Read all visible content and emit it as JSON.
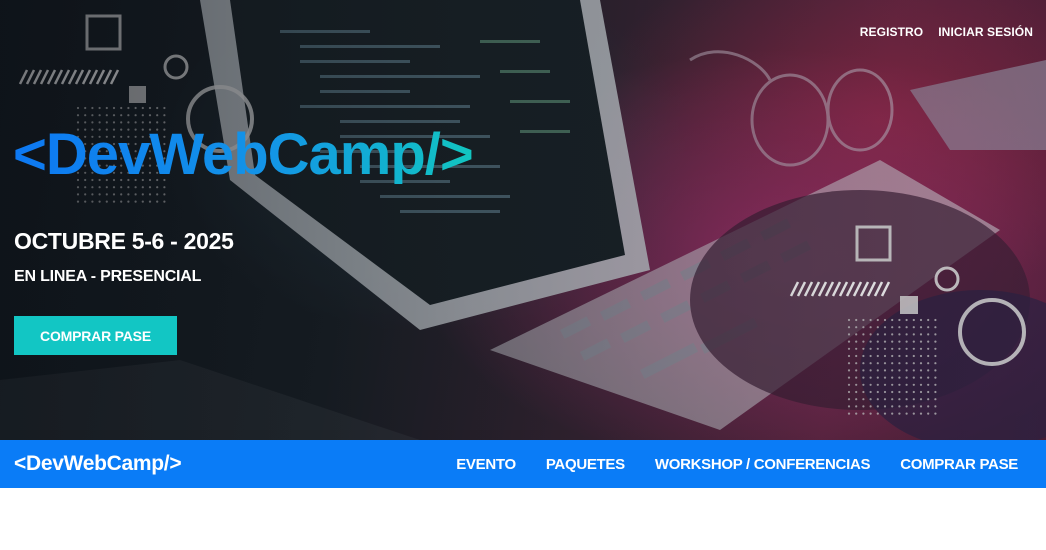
{
  "hero": {
    "auth": {
      "register_label": "REGISTRO",
      "login_label": "INICIAR SESIÓN"
    },
    "logo_text": "<DevWebCamp/>",
    "date": "OCTUBRE 5-6 - 2025",
    "mode": "EN LINEA - PRESENCIAL",
    "cta_label": "COMPRAR PASE",
    "colors": {
      "cta": "#12c6c4",
      "logo_gradient_start": "#0d78f2",
      "logo_gradient_end": "#12c6c0"
    }
  },
  "navbar": {
    "logo_text": "<DevWebCamp/>",
    "links": [
      {
        "label": "EVENTO"
      },
      {
        "label": "PAQUETES"
      },
      {
        "label": "WORKSHOP / CONFERENCIAS"
      },
      {
        "label": "COMPRAR PASE"
      }
    ],
    "colors": {
      "background": "#0a7cf7"
    }
  }
}
